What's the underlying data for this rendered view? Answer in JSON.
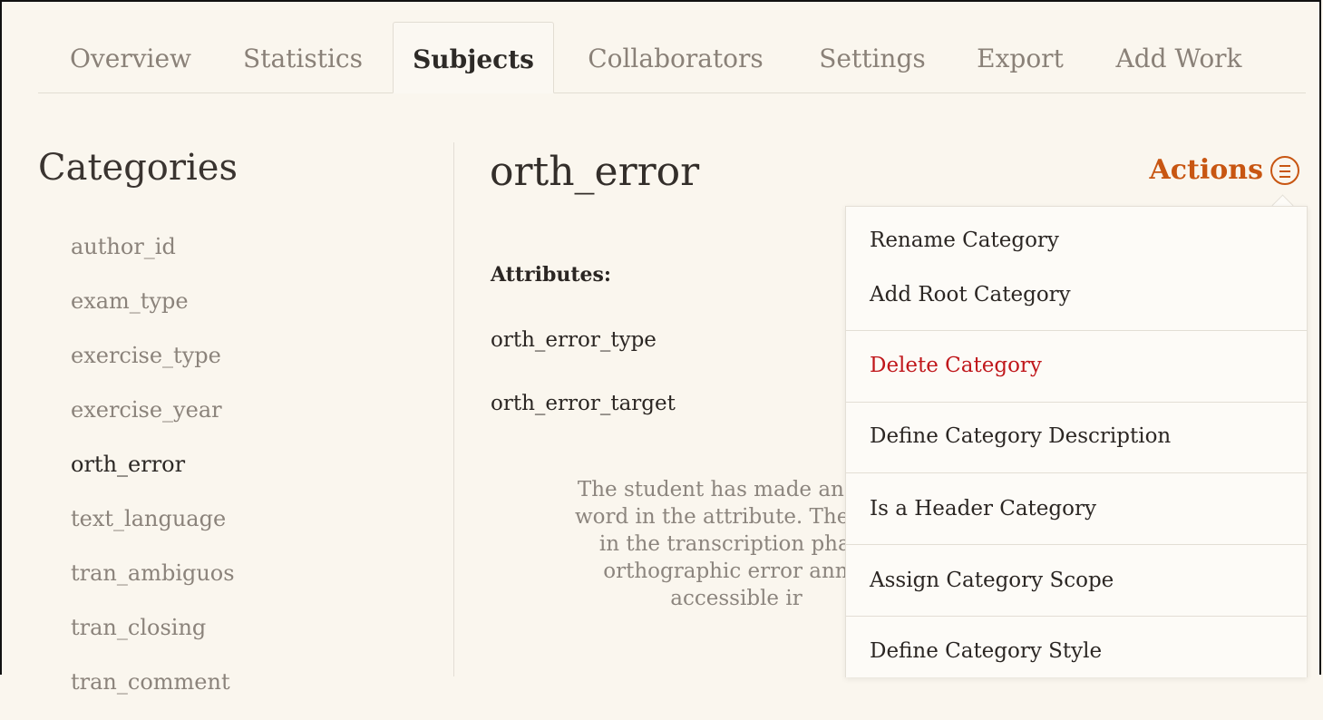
{
  "tabs": [
    {
      "label": "Overview",
      "active": false
    },
    {
      "label": "Statistics",
      "active": false
    },
    {
      "label": "Subjects",
      "active": true
    },
    {
      "label": "Collaborators",
      "active": false
    },
    {
      "label": "Settings",
      "active": false
    },
    {
      "label": "Export",
      "active": false
    },
    {
      "label": "Add Work",
      "active": false
    }
  ],
  "sidebar": {
    "title": "Categories",
    "items": [
      {
        "label": "author_id"
      },
      {
        "label": "exam_type"
      },
      {
        "label": "exercise_type"
      },
      {
        "label": "exercise_year"
      },
      {
        "label": "orth_error",
        "current": true
      },
      {
        "label": "text_language"
      },
      {
        "label": "tran_ambiguos"
      },
      {
        "label": "tran_closing"
      },
      {
        "label": "tran_comment"
      }
    ]
  },
  "main": {
    "title": "orth_error",
    "actions_label": "Actions",
    "attributes_label": "Attributes:",
    "attributes": [
      "orth_error_type",
      "orth_error_target"
    ],
    "description_lines": [
      "The student has made an orth",
      "word in the attribute. The sele",
      "in the transcription phase",
      "orthographic error annot",
      "accessible ir"
    ]
  },
  "menu": {
    "items": [
      {
        "label": "Rename Category"
      },
      {
        "label": "Add Root Category"
      },
      {
        "label": "Delete Category",
        "danger": true
      },
      {
        "label": "Define Category Description"
      },
      {
        "label": "Is a Header Category"
      },
      {
        "label": "Assign Category Scope"
      },
      {
        "label": "Define Category Style"
      }
    ]
  },
  "colors": {
    "accent": "#c85612",
    "danger": "#c0171b",
    "background": "#faf6ee"
  },
  "icons": {
    "actions": "hamburger-circle-icon"
  }
}
